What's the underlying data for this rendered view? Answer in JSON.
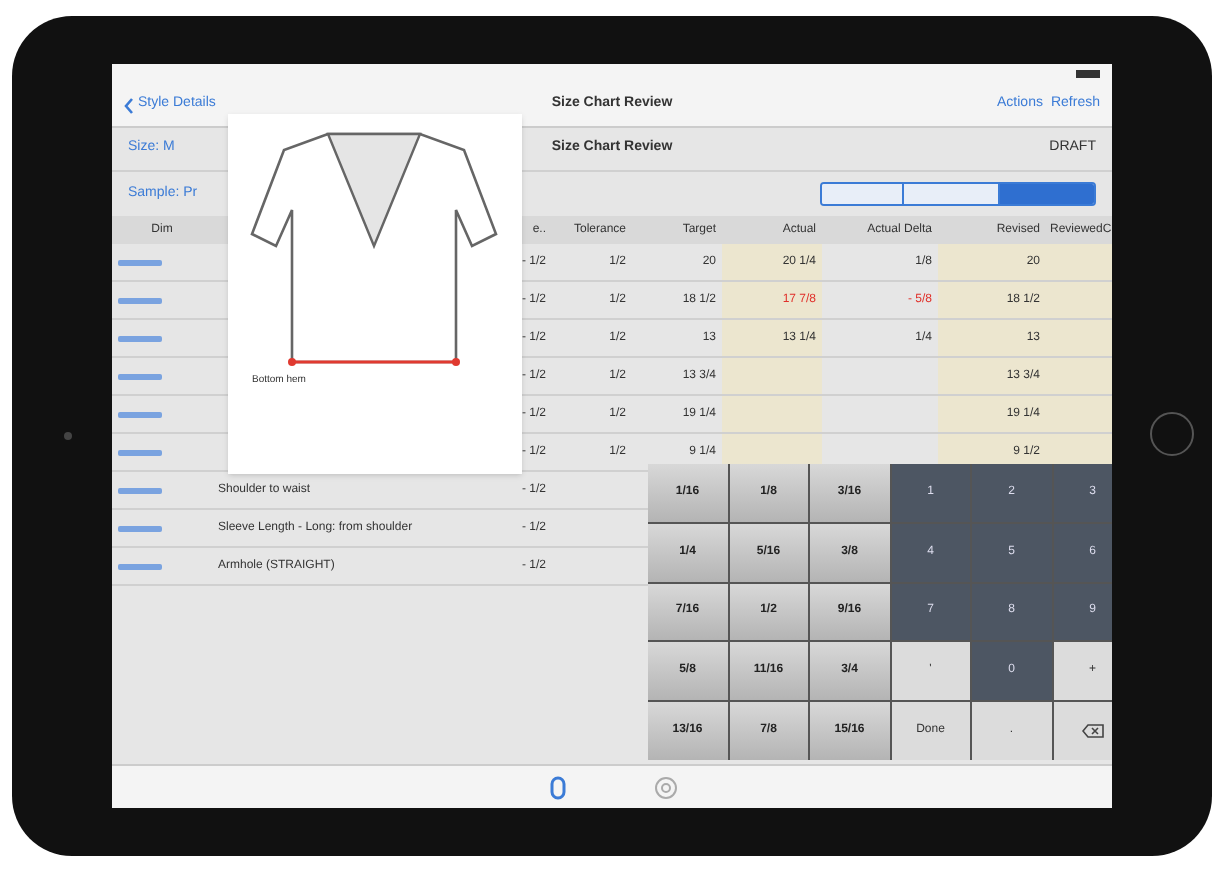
{
  "nav": {
    "back": "Style Details",
    "title": "Size Chart Review",
    "actions": [
      "Actions",
      "Refresh"
    ]
  },
  "info": {
    "size": "Size: M",
    "subtitle": "Size Chart Review",
    "status": "DRAFT",
    "sample": "Sample: Pr"
  },
  "segments": [
    {
      "selected": false
    },
    {
      "selected": false
    },
    {
      "selected": true
    }
  ],
  "columns": [
    "Dim",
    "e..",
    "Tolerance",
    "Target",
    "Actual",
    "Actual Delta",
    "Revised",
    "ReviewedC"
  ],
  "rows": [
    {
      "description": "",
      "minus": "- 1/2",
      "tolerance": "1/2",
      "target": "20",
      "actual": "20 1/4",
      "alert": false,
      "delta": "1/8",
      "revised": "20"
    },
    {
      "description": "",
      "minus": "- 1/2",
      "tolerance": "1/2",
      "target": "18 1/2",
      "actual": "17 7/8",
      "alert": true,
      "delta": "- 5/8",
      "revised": "18 1/2"
    },
    {
      "description": "",
      "minus": "- 1/2",
      "tolerance": "1/2",
      "target": "13",
      "actual": "13 1/4",
      "alert": false,
      "delta": "1/4",
      "revised": "13"
    },
    {
      "description": "",
      "minus": "- 1/2",
      "tolerance": "1/2",
      "target": "13 3/4",
      "actual": "",
      "delta": "",
      "revised": "13 3/4"
    },
    {
      "description": "",
      "minus": "- 1/2",
      "tolerance": "1/2",
      "target": "19 1/4",
      "actual": "",
      "delta": "",
      "revised": "19 1/4"
    },
    {
      "description": "",
      "minus": "- 1/2",
      "tolerance": "1/2",
      "target": "9 1/4",
      "actual": "",
      "delta": "",
      "revised": "9 1/2"
    },
    {
      "description": "Shoulder to waist",
      "minus": "- 1/2"
    },
    {
      "description": "Sleeve Length - Long: from shoulder",
      "minus": "- 1/2"
    },
    {
      "description": "Armhole (STRAIGHT)",
      "minus": "- 1/2"
    }
  ],
  "popup": {
    "caption": "Bottom hem"
  },
  "keypad": [
    {
      "label": "1/16",
      "kind": "fraction"
    },
    {
      "label": "1/8",
      "kind": "fraction"
    },
    {
      "label": "3/16",
      "kind": "fraction"
    },
    {
      "label": "1",
      "kind": "digit"
    },
    {
      "label": "2",
      "kind": "digit"
    },
    {
      "label": "3",
      "kind": "digit"
    },
    {
      "label": "1/4",
      "kind": "fraction"
    },
    {
      "label": "5/16",
      "kind": "fraction"
    },
    {
      "label": "3/8",
      "kind": "fraction"
    },
    {
      "label": "4",
      "kind": "digit"
    },
    {
      "label": "5",
      "kind": "digit"
    },
    {
      "label": "6",
      "kind": "digit"
    },
    {
      "label": "7/16",
      "kind": "fraction"
    },
    {
      "label": "1/2",
      "kind": "fraction"
    },
    {
      "label": "9/16",
      "kind": "fraction"
    },
    {
      "label": "7",
      "kind": "digit"
    },
    {
      "label": "8",
      "kind": "digit"
    },
    {
      "label": "9",
      "kind": "digit"
    },
    {
      "label": "5/8",
      "kind": "fraction"
    },
    {
      "label": "11/16",
      "kind": "fraction"
    },
    {
      "label": "3/4",
      "kind": "fraction"
    },
    {
      "label": "'",
      "kind": "action"
    },
    {
      "label": "0",
      "kind": "digit"
    },
    {
      "label": "+",
      "kind": "action"
    },
    {
      "label": "13/16",
      "kind": "fraction"
    },
    {
      "label": "7/8",
      "kind": "fraction"
    },
    {
      "label": "15/16",
      "kind": "fraction"
    },
    {
      "label": "Done",
      "kind": "action"
    },
    {
      "label": ".",
      "kind": "action"
    },
    {
      "kind": "delete"
    }
  ],
  "tabs": [
    {
      "selected": true
    },
    {
      "selected": false
    }
  ]
}
